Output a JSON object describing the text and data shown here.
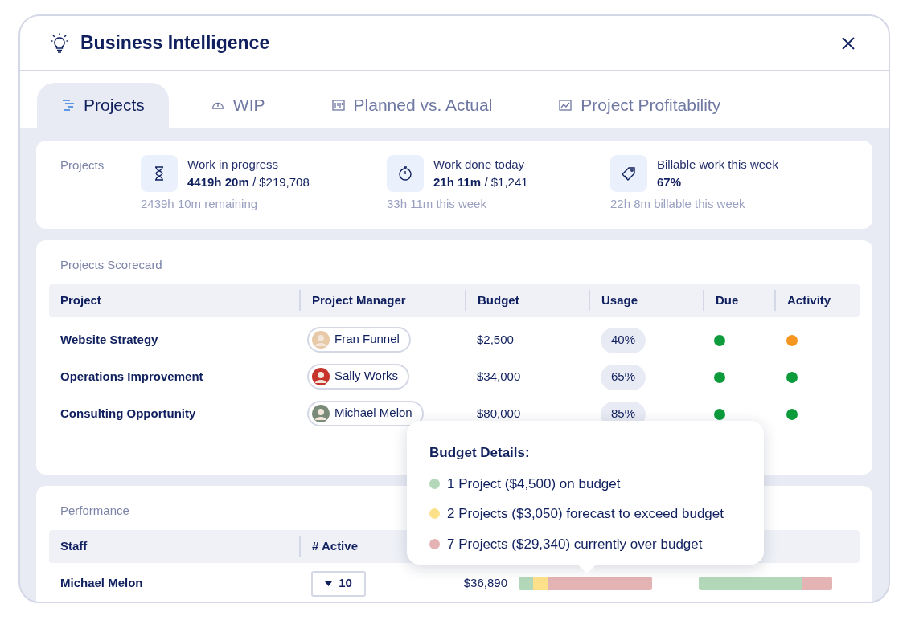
{
  "window": {
    "title": "Business Intelligence"
  },
  "tabs": [
    {
      "label": "Projects",
      "selected": true
    },
    {
      "label": "WIP",
      "selected": false
    },
    {
      "label": "Planned vs. Actual",
      "selected": false
    },
    {
      "label": "Project Profitability",
      "selected": false
    }
  ],
  "summary": {
    "title": "Projects",
    "stats": [
      {
        "label": "Work in progress",
        "value": "**4419h 20m** / $219,708",
        "note": "2439h 10m remaining"
      },
      {
        "label": "Work done today",
        "value": "**21h 11m** / $1,241",
        "note": "33h 11m this week"
      },
      {
        "label": "Billable work this week",
        "value": "**67%**",
        "note": "22h 8m billable this week"
      }
    ]
  },
  "scorecard": {
    "title": "Projects Scorecard",
    "columns": [
      "Project",
      "Project Manager",
      "Budget",
      "Usage",
      "Due",
      "Activity"
    ],
    "rows": [
      {
        "project": "Website Strategy",
        "manager": "Fran Funnel",
        "budget": "$2,500",
        "usage": "40%",
        "due": {
          "color": "#0d9b3c"
        },
        "activity": {
          "color": "#f6961e"
        }
      },
      {
        "project": "Operations Improvement",
        "manager": "Sally Works",
        "budget": "$34,000",
        "usage": "65%",
        "due": {
          "color": "#0d9b3c"
        },
        "activity": {
          "color": "#0d9b3c"
        }
      },
      {
        "project": "Consulting Opportunity",
        "manager": "Michael Melon",
        "budget": "$80,000",
        "usage": "85%",
        "due": {
          "color": "#0d9b3c"
        },
        "activity": {
          "color": "#0d9b3c"
        }
      }
    ]
  },
  "performance": {
    "title": "Performance",
    "columns": [
      "Staff",
      "# Active"
    ],
    "rows": [
      {
        "staff": "Michael Melon",
        "active": "10",
        "budget": "$36,890",
        "budget_bar": [
          {
            "level": 0.11,
            "color": "#b3d7b9"
          },
          {
            "level": 0.11,
            "color": "#fde18a"
          },
          {
            "level": 0.78,
            "color": "#e3b4b3"
          }
        ],
        "bar_2": [
          {
            "level": 0.77,
            "color": "#b3d7b9"
          },
          {
            "level": 0.23,
            "color": "#e3b4b3"
          }
        ]
      }
    ]
  },
  "tooltip": {
    "title": "Budget Details:",
    "items": [
      {
        "text": "1 Project ($4,500) on budget",
        "color": "#b3d7b9"
      },
      {
        "text": "2 Projects ($3,050) forecast to exceed budget",
        "color": "#fde18a"
      },
      {
        "text": "7 Projects ($29,340) currently over budget",
        "color": "#e3b4b3"
      }
    ]
  }
}
